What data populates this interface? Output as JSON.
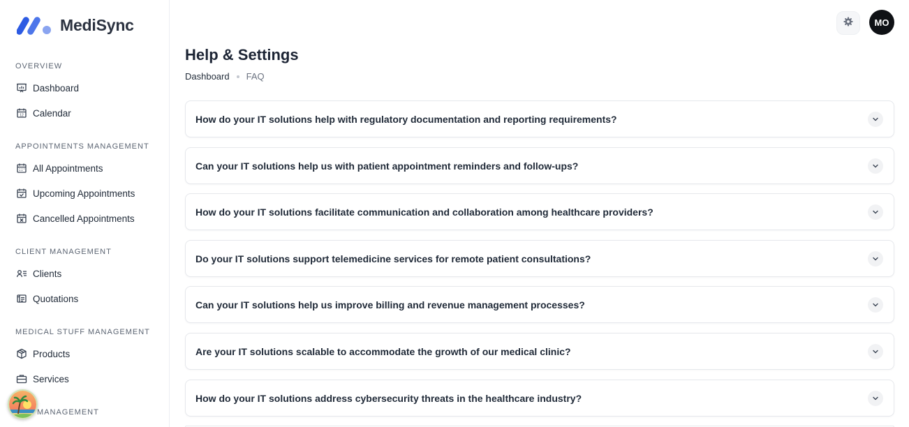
{
  "brand": {
    "name": "MediSync"
  },
  "sidebar": {
    "sections": [
      {
        "title": "OVERVIEW",
        "items": [
          {
            "label": "Dashboard",
            "icon": "presentation-chart-icon"
          },
          {
            "label": "Calendar",
            "icon": "calendar-icon"
          }
        ]
      },
      {
        "title": "APPOINTMENTS MANAGEMENT",
        "items": [
          {
            "label": "All Appointments",
            "icon": "calendar-grid-icon"
          },
          {
            "label": "Upcoming Appointments",
            "icon": "calendar-check-icon"
          },
          {
            "label": "Cancelled Appointments",
            "icon": "calendar-x-icon"
          }
        ]
      },
      {
        "title": "CLIENT MANAGEMENT",
        "items": [
          {
            "label": "Clients",
            "icon": "user-list-icon"
          },
          {
            "label": "Quotations",
            "icon": "receipt-icon"
          }
        ]
      },
      {
        "title": "MEDICAL STUFF MANAGEMENT",
        "items": [
          {
            "label": "Products",
            "icon": "box-icon"
          },
          {
            "label": "Services",
            "icon": "briefcase-icon"
          }
        ]
      },
      {
        "title": "MANAGEMENT",
        "items": []
      }
    ]
  },
  "header": {
    "user_initials": "MO",
    "settings_icon": "gear-icon"
  },
  "page": {
    "title": "Help & Settings",
    "breadcrumb": [
      "Dashboard",
      "FAQ"
    ]
  },
  "faq": [
    {
      "question": "How do your IT solutions help with regulatory documentation and reporting requirements?"
    },
    {
      "question": "Can your IT solutions help us with patient appointment reminders and follow-ups?"
    },
    {
      "question": "How do your IT solutions facilitate communication and collaboration among healthcare providers?"
    },
    {
      "question": "Do your IT solutions support telemedicine services for remote patient consultations?"
    },
    {
      "question": "Can your IT solutions help us improve billing and revenue management processes?"
    },
    {
      "question": "Are your IT solutions scalable to accommodate the growth of our medical clinic?"
    },
    {
      "question": "How do your IT solutions address cybersecurity threats in the healthcare industry?"
    }
  ],
  "colors": {
    "brand_dark": "#2d5be3",
    "brand_light": "#8aa4f0",
    "text": "#1c2434",
    "muted": "#5b6472"
  }
}
